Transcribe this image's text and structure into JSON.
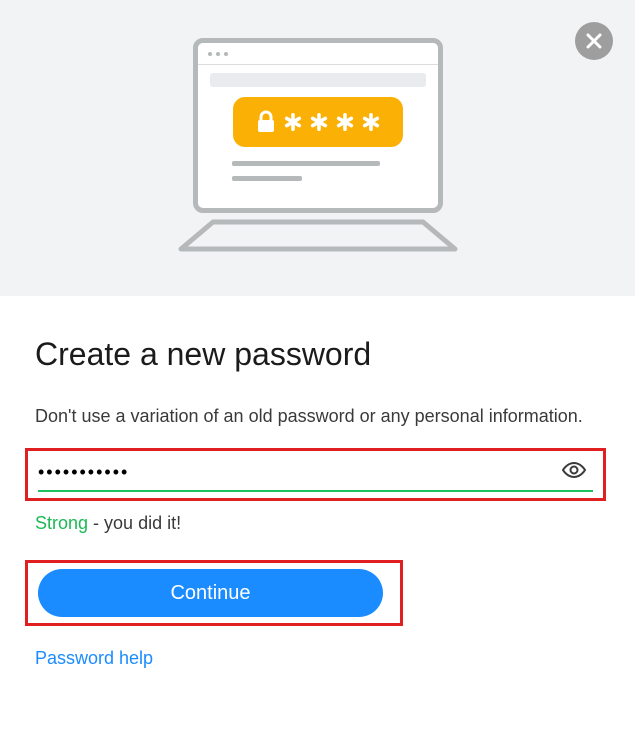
{
  "header": {
    "title": "Create a new password",
    "subtitle": "Don't use a variation of an old password or any personal information."
  },
  "password": {
    "value": "•••••••••••",
    "strength_label": "Strong",
    "strength_suffix": " - you did it!"
  },
  "actions": {
    "continue_label": "Continue",
    "help_label": "Password help"
  },
  "icons": {
    "close": "close",
    "eye": "eye"
  }
}
